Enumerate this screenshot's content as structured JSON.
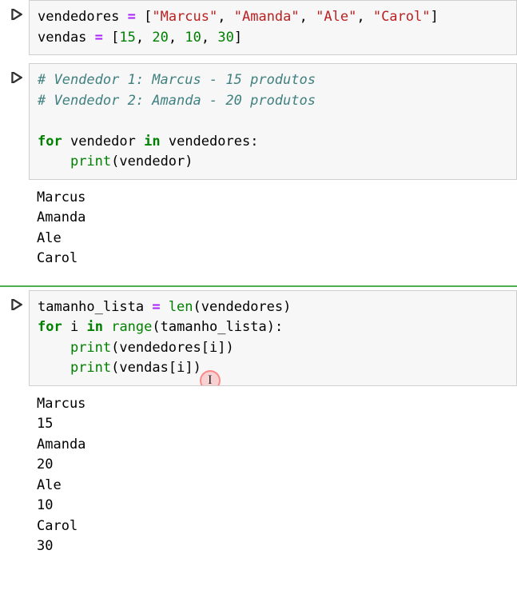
{
  "cells": {
    "c1": {
      "prompt_icon": "run-icon",
      "code": {
        "line1": {
          "var": "vendedores",
          "eq": "=",
          "lb": "[",
          "s1": "\"Marcus\"",
          "c1": ",",
          "s2": "\"Amanda\"",
          "c2": ",",
          "s3": "\"Ale\"",
          "c3": ",",
          "s4": "\"Carol\"",
          "rb": "]"
        },
        "line2": {
          "var": "vendas",
          "eq": "=",
          "lb": "[",
          "n1": "15",
          "c1": ",",
          "n2": "20",
          "c2": ",",
          "n3": "10",
          "c3": ",",
          "n4": "30",
          "rb": "]"
        }
      }
    },
    "c2": {
      "prompt_icon": "run-icon",
      "code": {
        "cmt1": "# Vendedor 1: Marcus - 15 produtos",
        "cmt2": "# Vendedor 2: Amanda - 20 produtos",
        "for_kw": "for",
        "loop_var": "vendedor",
        "in_kw": "in",
        "iter": "vendedores",
        "colon": ":",
        "print_name": "print",
        "lp": "(",
        "arg": "vendedor",
        "rp": ")"
      },
      "output": "Marcus\nAmanda\nAle\nCarol"
    },
    "c3": {
      "prompt_icon": "run-icon",
      "code": {
        "l1": {
          "var": "tamanho_lista",
          "eq": "=",
          "len": "len",
          "lp": "(",
          "arg": "vendedores",
          "rp": ")"
        },
        "l2": {
          "for_kw": "for",
          "i": "i",
          "in_kw": "in",
          "range": "range",
          "lp": "(",
          "arg": "tamanho_lista",
          "rp": ")",
          "colon": ":"
        },
        "l3": {
          "print": "print",
          "lp": "(",
          "base": "vendedores",
          "lb": "[",
          "idx": "i",
          "rb": "]",
          "rp": ")"
        },
        "l4": {
          "print": "print",
          "lp": "(",
          "base": "vendas",
          "lb": "[",
          "idx": "i",
          "rb": "]",
          "rp": ")"
        }
      },
      "output": "Marcus\n15\nAmanda\n20\nAle\n10\nCarol\n30",
      "cursor_glyph": "I"
    }
  }
}
